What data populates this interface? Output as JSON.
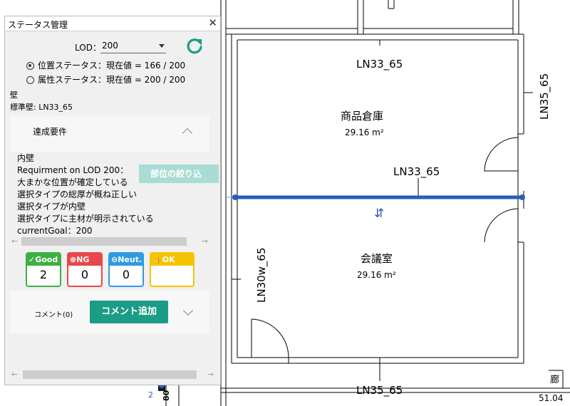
{
  "panel": {
    "title": "ステータス管理",
    "lod_label": "LOD：",
    "lod_value": "200",
    "radio_position": "位置ステータス：現在値 = 166 / 200",
    "radio_attribute": "属性ステータス：現在値 = 200 / 200",
    "category": "壁",
    "wall_type": "標準壁: LN33_65",
    "requirements_title": "達成要件",
    "filter_button": "部位の絞り込",
    "requirements": [
      "内壁",
      "Requirment on LOD 200：",
      "大まかな位置が確定している",
      "選択タイプの総厚が概ね正しい",
      "選択タイプが内壁",
      "選択タイプに主材が明示されている",
      "currentGoal：200"
    ],
    "statuses": [
      {
        "label": "Good",
        "icon": "✓",
        "count": "2",
        "color": "#3cb043"
      },
      {
        "label": "NG",
        "icon": "⊗",
        "count": "0",
        "color": "#e8474c"
      },
      {
        "label": "Neut.",
        "icon": "⊖",
        "count": "0",
        "color": "#2f9ae0"
      },
      {
        "label": "OK",
        "icon": "👍",
        "count": "",
        "color": "#f5c400"
      }
    ],
    "comment_label": "コメント(0)",
    "comment_button": "コメント追加"
  },
  "cad": {
    "wall_top": "LN33_65",
    "room_1": "商品倉庫",
    "area_1": "29.16 m²",
    "wall_mid": "LN33_65",
    "wall_right": "LN35_65",
    "room_2": "会議室",
    "area_2": "29.16 m²",
    "wall_left": "LN30w_65",
    "wall_bottom": "LN35_65",
    "corridor": "廊",
    "corridor_area": "51.04",
    "marker_num": "2",
    "marker_text": "80",
    "flip_symbol": "⇵"
  },
  "colors": {
    "accent": "#1a9c86",
    "selection": "#2a5cb8"
  }
}
